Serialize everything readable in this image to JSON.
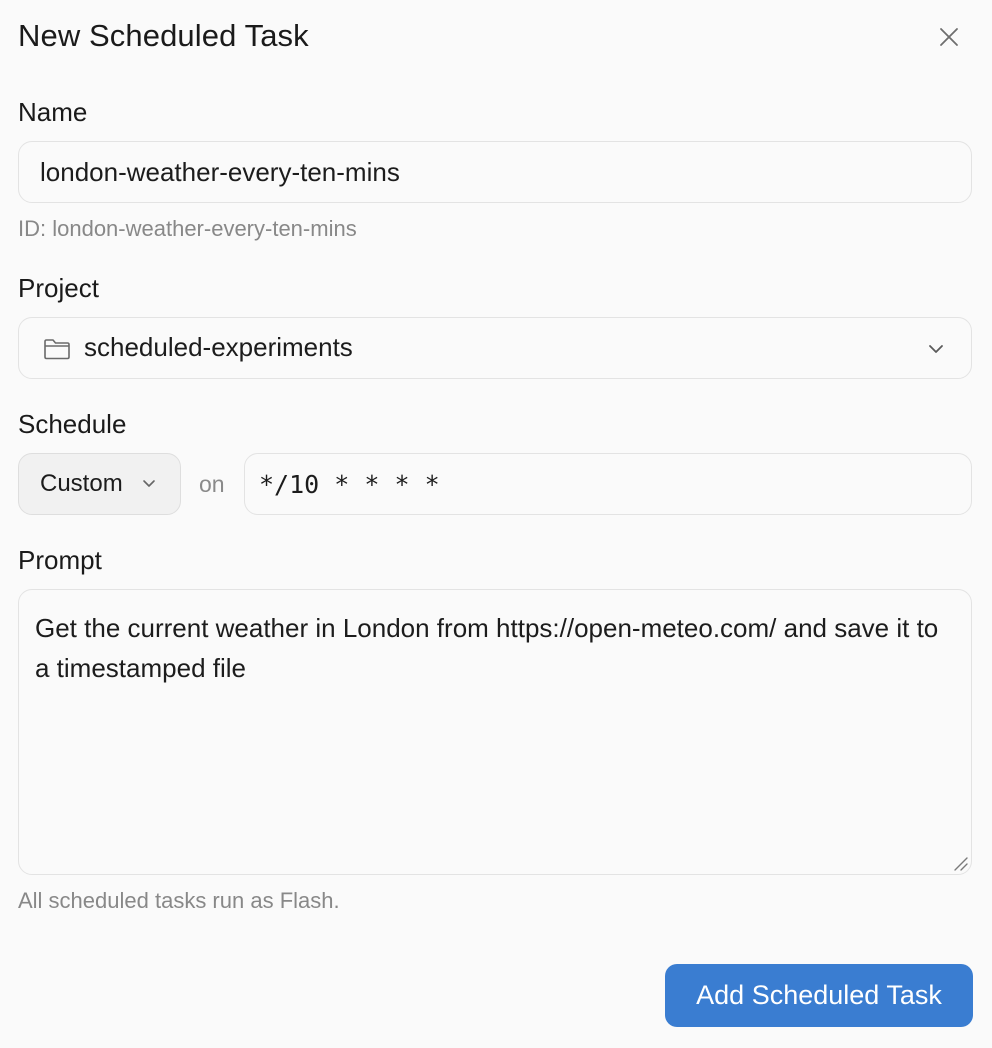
{
  "dialog": {
    "title": "New Scheduled Task",
    "close_icon": "close-icon"
  },
  "name": {
    "label": "Name",
    "value": "london-weather-every-ten-mins",
    "hint": "ID: london-weather-every-ten-mins"
  },
  "project": {
    "label": "Project",
    "value": "scheduled-experiments",
    "icon": "folder-icon"
  },
  "schedule": {
    "label": "Schedule",
    "mode": "Custom",
    "connector": "on",
    "cron": "*/10 * * * *"
  },
  "prompt": {
    "label": "Prompt",
    "value": "Get the current weather in London from https://open-meteo.com/ and save it to a timestamped file",
    "footnote": "All scheduled tasks run as Flash."
  },
  "actions": {
    "submit_label": "Add Scheduled Task"
  },
  "colors": {
    "accent": "#3a7dd1",
    "hint_text": "#888888",
    "border": "#e3e3e3"
  }
}
